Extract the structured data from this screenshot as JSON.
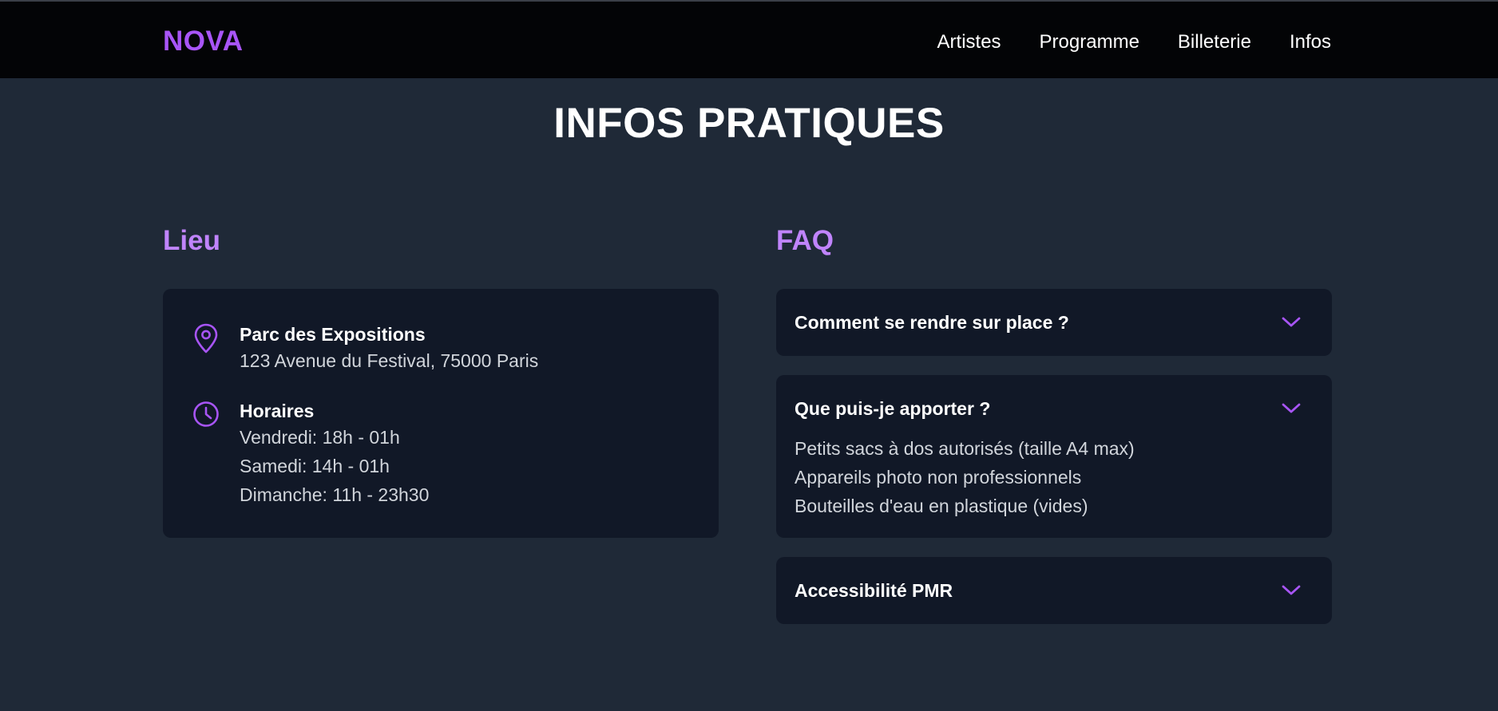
{
  "navbar": {
    "logo": "NOVA",
    "links": [
      "Artistes",
      "Programme",
      "Billeterie",
      "Infos"
    ]
  },
  "page": {
    "title": "INFOS PRATIQUES"
  },
  "lieu": {
    "heading": "Lieu",
    "venue": {
      "icon": "map-pin-icon",
      "title": "Parc des Expositions",
      "address": "123 Avenue du Festival, 75000 Paris"
    },
    "hours": {
      "icon": "clock-icon",
      "title": "Horaires",
      "lines": [
        "Vendredi: 18h - 01h",
        "Samedi: 14h - 01h",
        "Dimanche: 11h - 23h30"
      ]
    }
  },
  "faq": {
    "heading": "FAQ",
    "items": [
      {
        "question": "Comment se rendre sur place ?",
        "expanded": false,
        "answer": []
      },
      {
        "question": "Que puis-je apporter ?",
        "expanded": true,
        "answer": [
          "Petits sacs à dos autorisés (taille A4 max)",
          "Appareils photo non professionnels",
          "Bouteilles d'eau en plastique (vides)"
        ]
      },
      {
        "question": "Accessibilité PMR",
        "expanded": false,
        "answer": []
      }
    ]
  },
  "colors": {
    "accent": "#a855f7",
    "heading": "#c084fc",
    "background": "#1f2937",
    "card": "#111827",
    "navbar": "#030406"
  }
}
